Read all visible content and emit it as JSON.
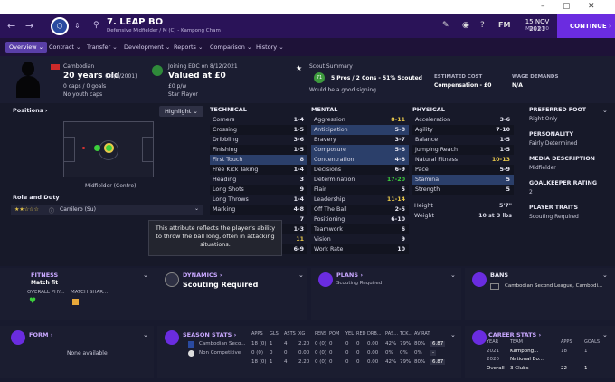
{
  "window": {
    "controls": [
      "–",
      "▢",
      "✕"
    ]
  },
  "header": {
    "badge": "⌄",
    "title": "7. LEAP BO",
    "subtitle": "Defensive Midfielder / M (C) - Kampong Cham",
    "date": "15 NOV 2021",
    "time": "Mon 8:00",
    "fm": "FM",
    "continue": "CONTINUE"
  },
  "tabs": [
    "Overview",
    "Contract",
    "Transfer",
    "Development",
    "Reports",
    "Comparison",
    "History"
  ],
  "player": {
    "nationality": "Cambodian",
    "age": "20 years old",
    "dob": "(28/6/2001)",
    "caps": "0 caps / 0 goals",
    "youth": "No youth caps",
    "joined": "Joining EDC on 8/12/2021",
    "value": "Valued at £0",
    "wage": "£0 p/w",
    "status": "Star Player",
    "scout_title": "Scout Summary",
    "scout_rating": "71",
    "scout_text": "5 Pros / 2 Cons - 51% Scouted",
    "scout_note": "Would be a good signing.",
    "est_cost_lbl": "ESTIMATED COST",
    "est_cost": "Compensation - £0",
    "wage_dem_lbl": "WAGE DEMANDS",
    "wage_dem": "N/A"
  },
  "positions": {
    "title": "Positions",
    "highlight": "Highlight",
    "label": "Midfielder (Centre)"
  },
  "role": {
    "title": "Role and Duty",
    "value": "Carrilero (Su)"
  },
  "technical": {
    "title": "TECHNICAL",
    "rows": [
      [
        "Corners",
        "1-4"
      ],
      [
        "Crossing",
        "1-5"
      ],
      [
        "Dribbling",
        "3-6"
      ],
      [
        "Finishing",
        "1-5"
      ],
      [
        "First Touch",
        "8"
      ],
      [
        "Free Kick Taking",
        "1-4"
      ],
      [
        "Heading",
        "3"
      ],
      [
        "Long Shots",
        "9"
      ],
      [
        "Long Throws",
        "1-4"
      ],
      [
        "Marking",
        "4-8"
      ],
      [
        "",
        "7"
      ],
      [
        "",
        "1-3"
      ],
      [
        "",
        "11"
      ],
      [
        "Technique",
        "6-9"
      ]
    ]
  },
  "mental": {
    "title": "MENTAL",
    "rows": [
      [
        "Aggression",
        "8-11"
      ],
      [
        "Anticipation",
        "5-8"
      ],
      [
        "Bravery",
        "3-7"
      ],
      [
        "Composure",
        "5-8"
      ],
      [
        "Concentration",
        "4-8"
      ],
      [
        "Decisions",
        "6-9"
      ],
      [
        "Determination",
        "17-20"
      ],
      [
        "Flair",
        "5"
      ],
      [
        "Leadership",
        "11-14"
      ],
      [
        "Off The Ball",
        "2-5"
      ],
      [
        "Positioning",
        "6-10"
      ],
      [
        "Teamwork",
        "6"
      ],
      [
        "Vision",
        "9"
      ],
      [
        "Work Rate",
        "10"
      ]
    ]
  },
  "physical": {
    "title": "PHYSICAL",
    "rows": [
      [
        "Acceleration",
        "3-6"
      ],
      [
        "Agility",
        "7-10"
      ],
      [
        "Balance",
        "1-5"
      ],
      [
        "Jumping Reach",
        "1-5"
      ],
      [
        "Natural Fitness",
        "10-13"
      ],
      [
        "Pace",
        "5-9"
      ],
      [
        "Stamina",
        "5"
      ],
      [
        "Strength",
        "5"
      ]
    ],
    "height_lbl": "Height",
    "height": "5'7\"",
    "weight_lbl": "Weight",
    "weight": "10 st 3 lbs"
  },
  "side": [
    [
      "PREFERRED FOOT",
      "Right Only"
    ],
    [
      "PERSONALITY",
      "Fairly Determined"
    ],
    [
      "MEDIA DESCRIPTION",
      "Midfielder"
    ],
    [
      "GOALKEEPER RATING",
      "2"
    ],
    [
      "PLAYER TRAITS",
      "Scouting Required"
    ]
  ],
  "tooltip": "This attribute reflects the player's ability to throw the ball long, often in attacking situations.",
  "fitness": {
    "title": "FITNESS",
    "value": "Match fit",
    "overall": "OVERALL PHY...",
    "sharp": "MATCH SHAR..."
  },
  "dynamics": {
    "title": "DYNAMICS",
    "value": "Scouting Required"
  },
  "plans": {
    "title": "PLANS",
    "value": "Scouting Required"
  },
  "bans": {
    "title": "BANS",
    "value": "Cambodian Second League, Cambodi..."
  },
  "form": {
    "title": "FORM",
    "value": "None available"
  },
  "season": {
    "title": "SEASON STATS",
    "cols": [
      "APPS",
      "GLS",
      "ASTS",
      "XG",
      "PENS",
      "POM",
      "YEL",
      "RED",
      "DRB...",
      "PAS...",
      "TCK...",
      "AV RAT"
    ],
    "rows": [
      [
        "Cambodian Seco...",
        "18 (0)",
        "1",
        "4",
        "2.20",
        "0 (0)",
        "0",
        "0",
        "0",
        "0.00",
        "42%",
        "79%",
        "80%",
        "6.87"
      ],
      [
        "Non Competitive",
        "0 (0)",
        "0",
        "0",
        "0.00",
        "0 (0)",
        "0",
        "0",
        "0",
        "0.00",
        "0%",
        "0%",
        "0%",
        "-"
      ],
      [
        "",
        "18 (0)",
        "1",
        "4",
        "2.20",
        "0 (0)",
        "0",
        "0",
        "0",
        "0.00",
        "42%",
        "79%",
        "80%",
        "6.87"
      ]
    ]
  },
  "career": {
    "title": "CAREER STATS",
    "cols": [
      "YEAR",
      "TEAM",
      "APPS",
      "GOALS"
    ],
    "rows": [
      [
        "2021",
        "Kampong...",
        "18",
        "1"
      ],
      [
        "2020",
        "National Bo...",
        "",
        ""
      ]
    ],
    "overall": "Overall",
    "clubs": "3 Clubs",
    "apps": "22",
    "goals": "1"
  }
}
